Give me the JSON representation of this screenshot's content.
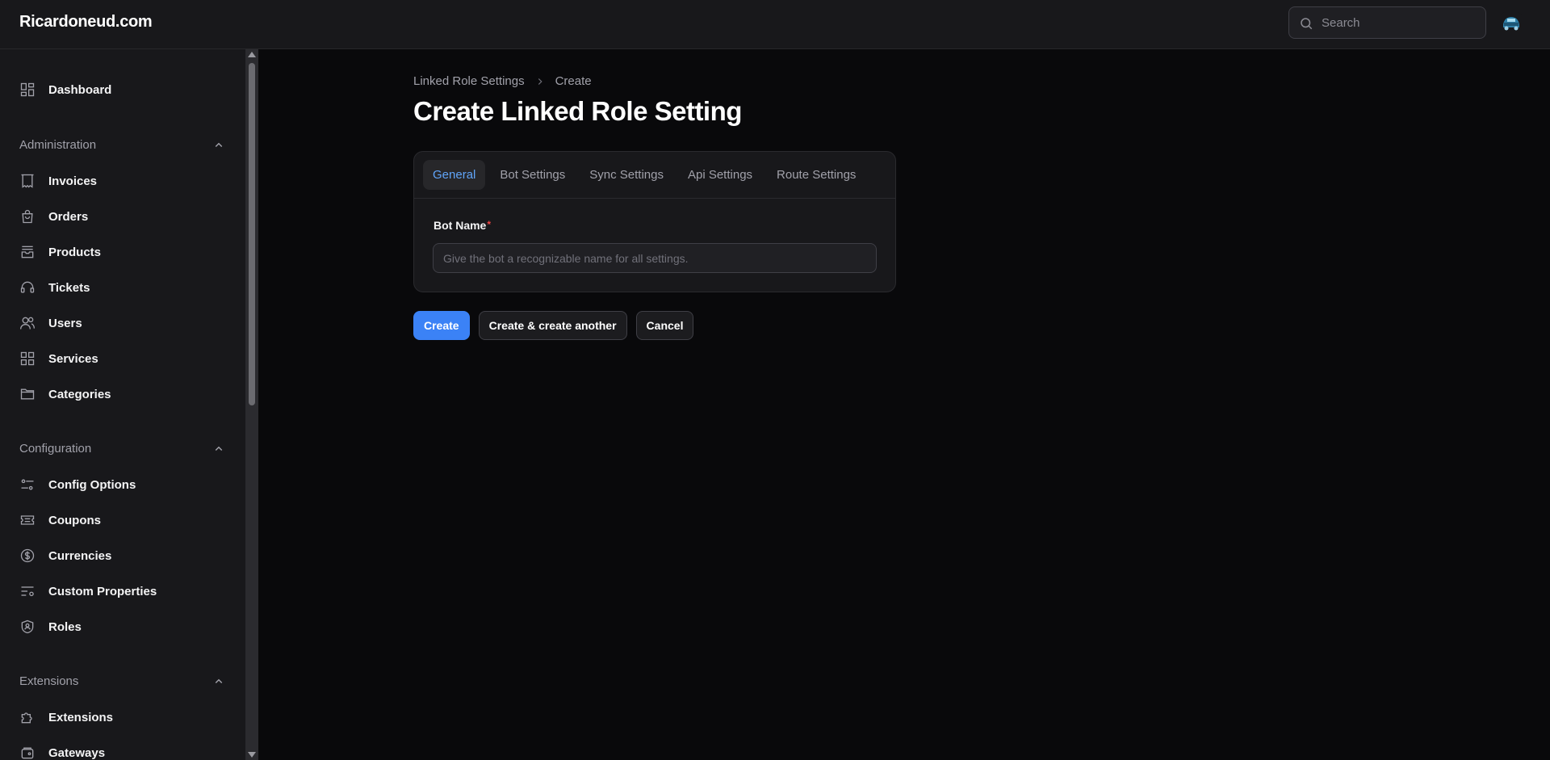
{
  "header": {
    "brand": "Ricardoneud.com",
    "search_placeholder": "Search",
    "avatar_icon": "user-avatar"
  },
  "sidebar": {
    "dashboard": {
      "label": "Dashboard",
      "icon": "dashboard-icon"
    },
    "groups": [
      {
        "label": "Administration",
        "items": [
          {
            "label": "Invoices",
            "icon": "invoice-icon"
          },
          {
            "label": "Orders",
            "icon": "shopping-bag-icon"
          },
          {
            "label": "Products",
            "icon": "archive-box-icon"
          },
          {
            "label": "Tickets",
            "icon": "headset-icon"
          },
          {
            "label": "Users",
            "icon": "users-icon"
          },
          {
            "label": "Services",
            "icon": "grid-icon"
          },
          {
            "label": "Categories",
            "icon": "folder-icon"
          }
        ]
      },
      {
        "label": "Configuration",
        "items": [
          {
            "label": "Config Options",
            "icon": "adjustments-icon"
          },
          {
            "label": "Coupons",
            "icon": "ticket-icon"
          },
          {
            "label": "Currencies",
            "icon": "currency-icon"
          },
          {
            "label": "Custom Properties",
            "icon": "list-settings-icon"
          },
          {
            "label": "Roles",
            "icon": "shield-user-icon"
          }
        ]
      },
      {
        "label": "Extensions",
        "items": [
          {
            "label": "Extensions",
            "icon": "puzzle-icon"
          },
          {
            "label": "Gateways",
            "icon": "wallet-icon"
          }
        ]
      }
    ]
  },
  "breadcrumb": {
    "parent": "Linked Role Settings",
    "current": "Create"
  },
  "page": {
    "title": "Create Linked Role Setting"
  },
  "form": {
    "tabs": [
      {
        "label": "General",
        "active": true
      },
      {
        "label": "Bot Settings",
        "active": false
      },
      {
        "label": "Sync Settings",
        "active": false
      },
      {
        "label": "Api Settings",
        "active": false
      },
      {
        "label": "Route Settings",
        "active": false
      }
    ],
    "bot_name_label": "Bot Name",
    "required_mark": "*",
    "bot_name_placeholder": "Give the bot a recognizable name for all settings.",
    "bot_name_value": ""
  },
  "actions": {
    "create": "Create",
    "create_another": "Create & create another",
    "cancel": "Cancel"
  },
  "colors": {
    "accent": "#3b82f6",
    "active_tab": "#60a5fa",
    "required": "#ef4444"
  }
}
